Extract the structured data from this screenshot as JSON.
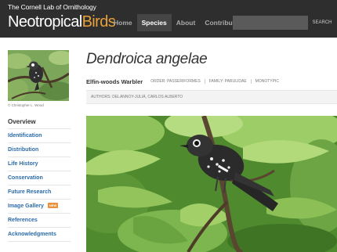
{
  "header": {
    "cornell_text": "The Cornell Lab of Ornithology",
    "site_name_part1": "Neotropical",
    "site_name_part2": "Birds",
    "nav": [
      {
        "label": "Home",
        "active": false
      },
      {
        "label": "Species",
        "active": true
      },
      {
        "label": "About",
        "active": false
      },
      {
        "label": "Contribute",
        "active": false
      }
    ],
    "search": {
      "value": "",
      "placeholder": "",
      "button_label": "SEARCH"
    }
  },
  "sidebar": {
    "photo_credit": "© Christopher L. Wood",
    "menu": [
      {
        "label": "Overview",
        "active": true,
        "badge": ""
      },
      {
        "label": "Identification",
        "active": false,
        "badge": ""
      },
      {
        "label": "Distribution",
        "active": false,
        "badge": ""
      },
      {
        "label": "Life History",
        "active": false,
        "badge": ""
      },
      {
        "label": "Conservation",
        "active": false,
        "badge": ""
      },
      {
        "label": "Future Research",
        "active": false,
        "badge": ""
      },
      {
        "label": "Image Gallery",
        "active": false,
        "badge": "NEW"
      },
      {
        "label": "References",
        "active": false,
        "badge": ""
      },
      {
        "label": "Acknowledgments",
        "active": false,
        "badge": ""
      }
    ]
  },
  "species": {
    "scientific_name": "Dendroica angelae",
    "common_name": "Elfin-woods Warbler",
    "order": "ORDER: PASSERIFORMES",
    "family": "FAMILY: PARULIDAE",
    "status": "MONOTYPIC",
    "authors": "AUTHORS:  DELANNOY-JULIÁ, CARLOS ALBERTO"
  },
  "colors": {
    "header_bg": "#2e2e2e",
    "brand_accent": "#e8a13a",
    "link_blue": "#2b6ba8",
    "badge_orange": "#e8913a"
  }
}
